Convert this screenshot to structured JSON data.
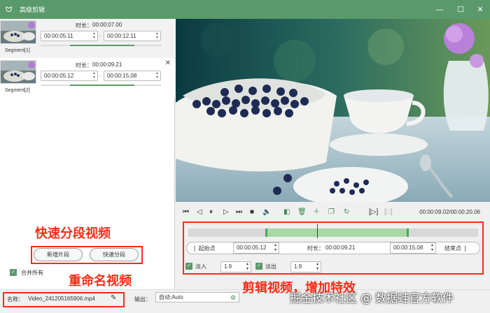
{
  "window": {
    "title": "高级剪辑",
    "minimize": "—",
    "maximize": "☐",
    "close": "✕"
  },
  "segments": [
    {
      "label": "Segment[1]",
      "duration_label": "时长：",
      "duration": "00:00:07.00",
      "start": "00:00:05.11",
      "end": "00:00:12.11",
      "dash": "-",
      "active": true
    },
    {
      "label": "Segment[2]",
      "duration_label": "时长：",
      "duration": "00:00:09.21",
      "start": "00:00:05.12",
      "end": "00:00:15.08",
      "dash": "-",
      "active": false,
      "close": "✕"
    }
  ],
  "annotations": {
    "split": "快速分段视频",
    "rename": "重命名视频",
    "edit": "剪辑视频，增加特效",
    "watermark": "掘金技术社区 @ 数据蛙官方软件"
  },
  "buttons": {
    "add_segment": "新增片段",
    "quick_split": "快速分段"
  },
  "merge_all": {
    "label": "合并所有",
    "checked": true
  },
  "output": {
    "name_label": "名称：",
    "name_value": "Video_241205165906.mp4",
    "output_label": "输出：",
    "output_value": "自动:Auto"
  },
  "player": {
    "time_readout": "00:00:09.02/00:00:20.06"
  },
  "edit": {
    "start_btn": "起始点",
    "start_time": "00:00:05.12",
    "duration_label": "时长：",
    "duration": "00:00:09.21",
    "end_time": "00:00:15.08",
    "end_btn": "结束点",
    "fade_in": {
      "label": "淡入",
      "value": "1.9",
      "checked": true
    },
    "fade_out": {
      "label": "淡出",
      "value": "1.9",
      "checked": true
    }
  },
  "colors": {
    "accent": "#5a9a6a",
    "annotation": "#ff2a14"
  }
}
